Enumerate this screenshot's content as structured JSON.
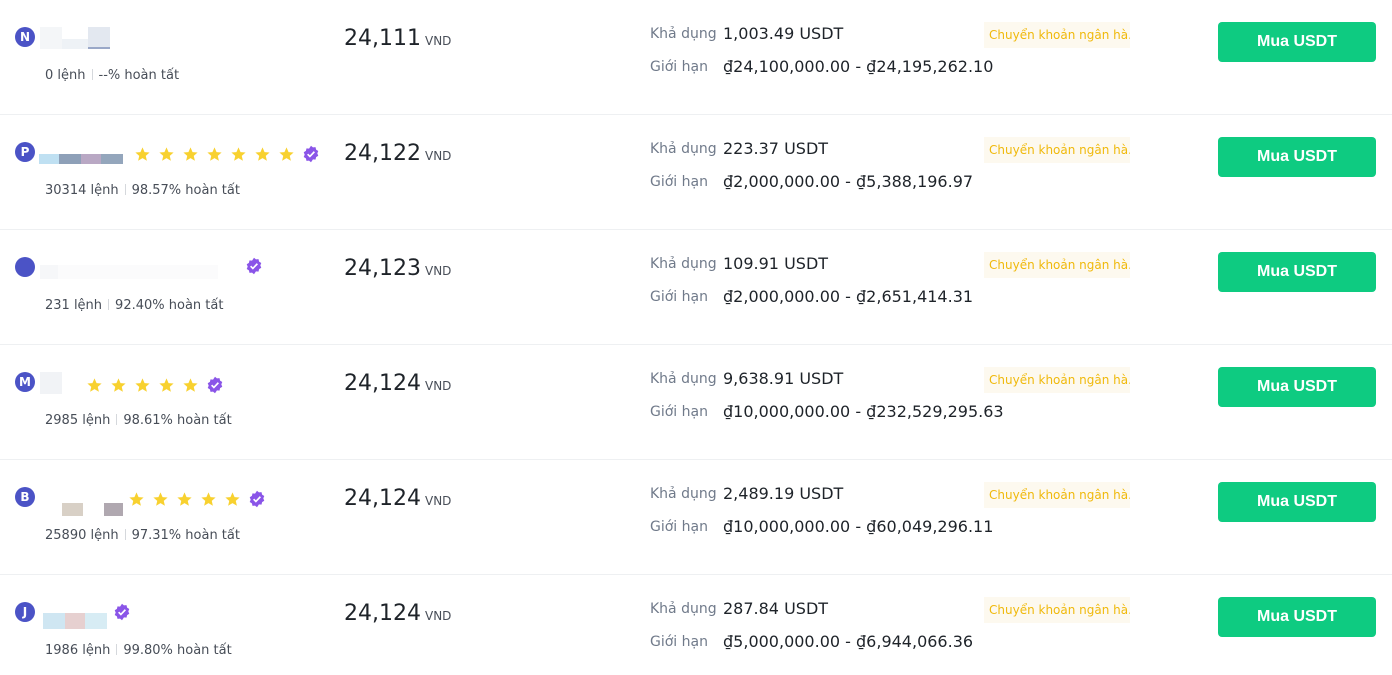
{
  "labels": {
    "available": "Khả dụng",
    "limit": "Giới hạn",
    "orders_suffix": "lệnh",
    "completion_suffix": "hoàn tất",
    "currency": "VND",
    "payment": "Chuyển khoản ngân hà...",
    "buy_button": "Mua USDT"
  },
  "colors": {
    "buy_button": "#0ecb81",
    "payment_text": "#f0b90b",
    "payment_bg": "#fdf9ef",
    "avatar": "#4b53c6",
    "star": "#f8d12f",
    "verified": "#8a55e8"
  },
  "offers": [
    {
      "initial": "N",
      "stars": 0,
      "verified": false,
      "orders": "0 lệnh",
      "completion": "--% hoàn tất",
      "price": "24,111",
      "available": "1,003.49 USDT",
      "limit": "₫24,100,000.00 - ₫24,195,262.10"
    },
    {
      "initial": "P",
      "stars": 7,
      "verified": true,
      "orders": "30314 lệnh",
      "completion": "98.57% hoàn tất",
      "price": "24,122",
      "available": "223.37 USDT",
      "limit": "₫2,000,000.00 - ₫5,388,196.97"
    },
    {
      "initial": "",
      "stars": 0,
      "verified": true,
      "orders": "231 lệnh",
      "completion": "92.40% hoàn tất",
      "price": "24,123",
      "available": "109.91 USDT",
      "limit": "₫2,000,000.00 - ₫2,651,414.31"
    },
    {
      "initial": "M",
      "stars": 5,
      "verified": true,
      "orders": "2985 lệnh",
      "completion": "98.61% hoàn tất",
      "price": "24,124",
      "available": "9,638.91 USDT",
      "limit": "₫10,000,000.00 - ₫232,529,295.63"
    },
    {
      "initial": "B",
      "stars": 5,
      "verified": true,
      "orders": "25890 lệnh",
      "completion": "97.31% hoàn tất",
      "price": "24,124",
      "available": "2,489.19 USDT",
      "limit": "₫10,000,000.00 - ₫60,049,296.11"
    },
    {
      "initial": "J",
      "stars": 0,
      "verified": true,
      "orders": "1986 lệnh",
      "completion": "99.80% hoàn tất",
      "price": "24,124",
      "available": "287.84 USDT",
      "limit": "₫5,000,000.00 - ₫6,944,066.36"
    }
  ]
}
